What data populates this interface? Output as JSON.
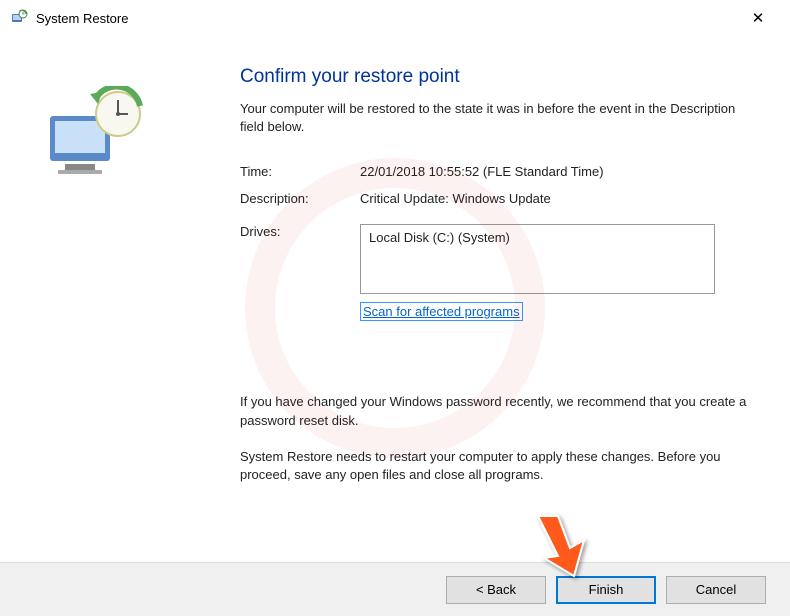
{
  "titlebar": {
    "title": "System Restore"
  },
  "heading": "Confirm your restore point",
  "intro": "Your computer will be restored to the state it was in before the event in the Description field below.",
  "fields": {
    "time_label": "Time:",
    "time_value": "22/01/2018 10:55:52 (FLE Standard Time)",
    "description_label": "Description:",
    "description_value": "Critical Update: Windows Update",
    "drives_label": "Drives:",
    "drives_value": "Local Disk (C:) (System)"
  },
  "scan_link": "Scan for affected programs",
  "note1": "If you have changed your Windows password recently, we recommend that you create a password reset disk.",
  "note2": "System Restore needs to restart your computer to apply these changes. Before you proceed, save any open files and close all programs.",
  "buttons": {
    "back": "< Back",
    "finish": "Finish",
    "cancel": "Cancel"
  }
}
